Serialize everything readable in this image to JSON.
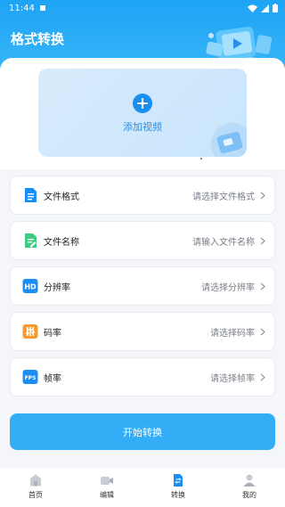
{
  "status_bar": {
    "time": "11:44"
  },
  "header": {
    "title": "格式转换"
  },
  "upload": {
    "label": "添加视频"
  },
  "options": [
    {
      "label": "文件格式",
      "value": "请选择文件格式",
      "icon": "document-icon",
      "color": "#1a8ef5"
    },
    {
      "label": "文件名称",
      "value": "请输入文件名称",
      "icon": "edit-file-icon",
      "color": "#3fcb84"
    },
    {
      "label": "分辨率",
      "value": "请选择分辨率",
      "icon": "hd-icon",
      "color": "#1a8ef5",
      "badge": "HD"
    },
    {
      "label": "码率",
      "value": "请选择码率",
      "icon": "equalizer-icon",
      "color": "#f59a2c"
    },
    {
      "label": "帧率",
      "value": "请选择帧率",
      "icon": "fps-icon",
      "color": "#1a8ef5",
      "badge": "FPS"
    }
  ],
  "start_button": {
    "label": "开始转换"
  },
  "tabs": [
    {
      "label": "首页",
      "icon": "home-icon",
      "active": false
    },
    {
      "label": "编辑",
      "icon": "video-camera-icon",
      "active": false
    },
    {
      "label": "转换",
      "icon": "convert-icon",
      "active": true
    },
    {
      "label": "我的",
      "icon": "profile-icon",
      "active": false
    }
  ],
  "colors": {
    "primary": "#33adf6",
    "header": "#1ea3f5",
    "accent": "#1a8ef5"
  }
}
